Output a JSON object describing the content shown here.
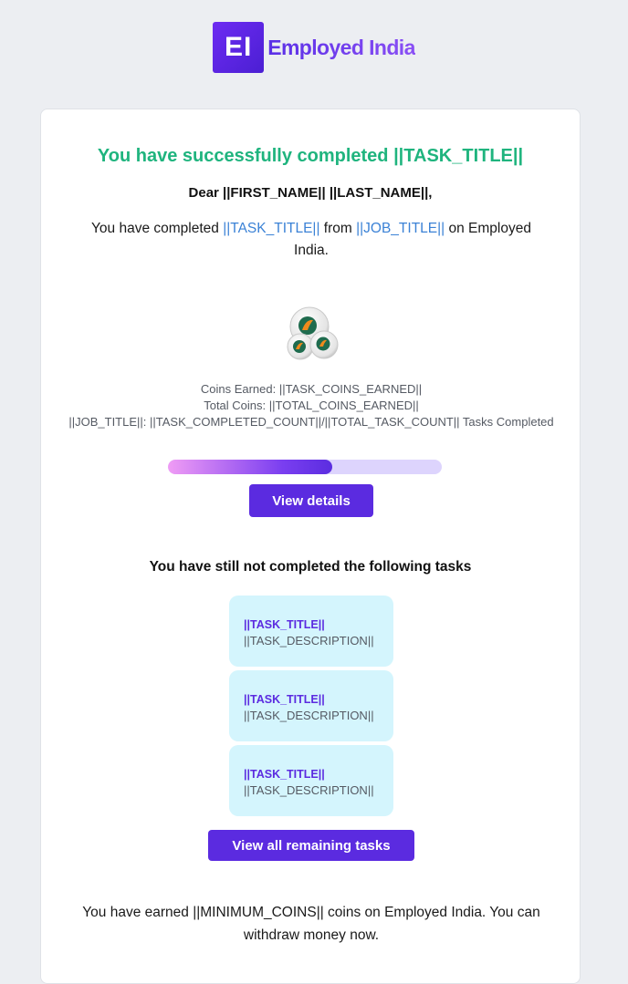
{
  "brand": {
    "logo_mark": "EI",
    "name": "Employed India",
    "accent": "#5b2be0"
  },
  "title": "You have successfully completed ||TASK_TITLE||",
  "greeting": "Dear ||FIRST_NAME|| ||LAST_NAME||,",
  "completed_message": {
    "prefix": "You have completed ",
    "task_link": "||TASK_TITLE||",
    "middle": " from ",
    "job_link": "||JOB_TITLE||",
    "suffix": " on Employed India."
  },
  "coins_icon": "coins-icon",
  "stats": {
    "coins_earned": "Coins Earned: ||TASK_COINS_EARNED||",
    "total_coins": "Total Coins: ||TOTAL_COINS_EARNED||",
    "tasks_completed": "||JOB_TITLE||: ||TASK_COMPLETED_COUNT||/||TOTAL_TASK_COUNT|| Tasks Completed"
  },
  "progress": {
    "value": 0.6
  },
  "view_details_label": "View details",
  "pending_heading": "You have still not completed the following tasks",
  "tasks": [
    {
      "title": "||TASK_TITLE||",
      "description": "||TASK_DESCRIPTION||"
    },
    {
      "title": "||TASK_TITLE||",
      "description": "||TASK_DESCRIPTION||"
    },
    {
      "title": "||TASK_TITLE||",
      "description": "||TASK_DESCRIPTION||"
    }
  ],
  "view_remaining_label": "View all remaining tasks",
  "earned_message": "You have earned ||MINIMUM_COINS|| coins on Employed India. You can withdraw money now.",
  "colors": {
    "title_green": "#1fb47e",
    "link_blue": "#3b82d6",
    "task_bg": "#d4f5fd",
    "page_bg": "#eceef2"
  }
}
